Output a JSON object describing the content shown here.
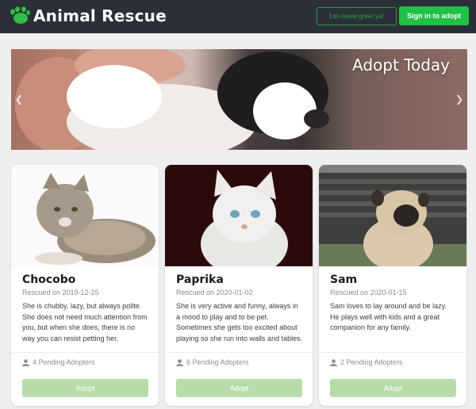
{
  "header": {
    "brand": "Animal Rescue",
    "outline_button": "Let meow greet ya!",
    "signin_button": "Sign in to adopt",
    "logo_icon": "paw-icon",
    "accent": "#20c146"
  },
  "hero": {
    "title": "Adopt Today",
    "prev_icon": "chevron-left-icon",
    "next_icon": "chevron-right-icon"
  },
  "cards": [
    {
      "name": "Chocobo",
      "rescued": "Rescued on 2019-12-25",
      "description": "She is chubby, lazy, but always polite. She does not need much attention from you, but when she does, there is no way you can resist petting her.",
      "pending": "4 Pending Adopters",
      "adopt": "Adopt"
    },
    {
      "name": "Paprika",
      "rescued": "Rescued on 2020-01-02",
      "description": "She is very active and funny, always in a mood to play and to be pet. Sometimes she gets too excited about playing so she run into walls and tables.",
      "pending": "6 Pending Adopters",
      "adopt": "Adopt"
    },
    {
      "name": "Sam",
      "rescued": "Rescued on 2020-01-15",
      "description": "Sam loves to lay around and be lazy. He plays well with kids and a great companion for any family.",
      "pending": "2 Pending Adopters",
      "adopt": "Adopt"
    }
  ]
}
